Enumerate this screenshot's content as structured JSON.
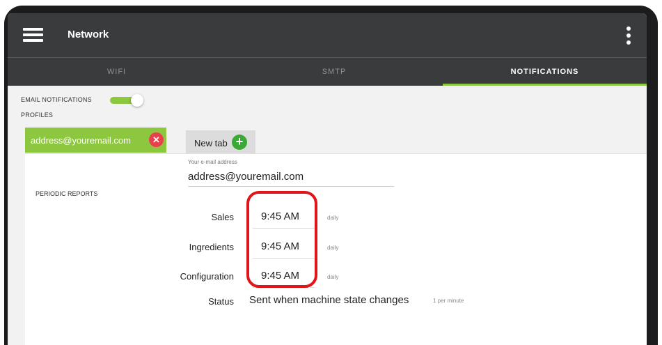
{
  "app_bar": {
    "menu_icon": "hamburger-menu-icon",
    "title": "Network",
    "overflow_icon": "more-vertical-icon"
  },
  "tabs": [
    {
      "label": "WIFI",
      "active": false
    },
    {
      "label": "SMTP",
      "active": false
    },
    {
      "label": "NOTIFICATIONS",
      "active": true
    }
  ],
  "colors": {
    "accent": "#8dc63f",
    "app_bar": "#3a3b3d",
    "remove": "#e8414d",
    "add": "#3aaa35",
    "highlight": "#e1141a"
  },
  "email_notifications": {
    "label": "EMAIL NOTIFICATIONS",
    "enabled": true
  },
  "profiles": {
    "label": "PROFILES",
    "tabs": [
      {
        "label": "address@youremail.com",
        "icon": "close-icon",
        "active": true
      }
    ],
    "new_tab": {
      "label": "New tab",
      "icon": "plus-icon"
    }
  },
  "profile": {
    "email_caption": "Your e-mail address",
    "email_value": "address@youremail.com",
    "periodic_reports_label": "PERIODIC REPORTS",
    "reports": [
      {
        "label": "Sales",
        "time": "9:45 AM",
        "frequency": "daily"
      },
      {
        "label": "Ingredients",
        "time": "9:45 AM",
        "frequency": "daily"
      },
      {
        "label": "Configuration",
        "time": "9:45 AM",
        "frequency": "daily"
      }
    ],
    "status": {
      "label": "Status",
      "value": "Sent when machine state changes",
      "rate": "1 per minute"
    }
  }
}
